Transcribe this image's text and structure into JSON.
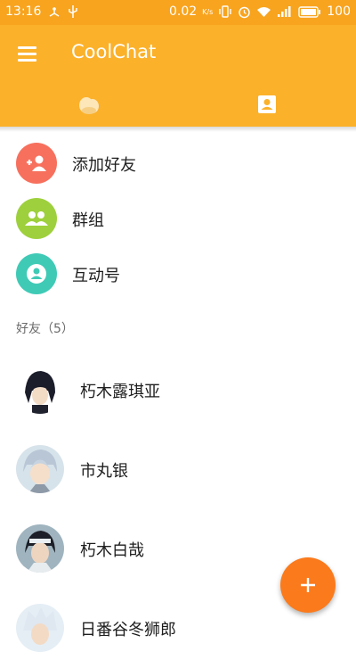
{
  "status_bar": {
    "time": "13:16",
    "net_speed": "0.02",
    "net_unit": "K/s",
    "battery": "100",
    "icons": [
      "usb-share-icon",
      "usb-icon",
      "vibrate-icon",
      "alarm-icon",
      "wifi-icon",
      "signal-icon",
      "battery-icon"
    ]
  },
  "app": {
    "title": "CoolChat",
    "accent": "#fbb12a",
    "status_color": "#f8a41f"
  },
  "tabs": [
    {
      "name": "conversations",
      "icon": "mascot-icon",
      "active": false
    },
    {
      "name": "contacts",
      "icon": "contact-card-icon",
      "active": true
    }
  ],
  "actions": [
    {
      "label": "添加好友",
      "icon": "add-person-icon",
      "color": "#f7705d"
    },
    {
      "label": "群组",
      "icon": "group-icon",
      "color": "#9ed03d"
    },
    {
      "label": "互动号",
      "icon": "account-circle-icon",
      "color": "#3fcab6"
    }
  ],
  "friends_header": "好友（5）",
  "friends": [
    {
      "name": "朽木露琪亚"
    },
    {
      "name": "市丸银"
    },
    {
      "name": "朽木白哉"
    },
    {
      "name": "日番谷冬狮郎"
    }
  ],
  "fab": {
    "icon": "plus-icon",
    "color": "#fb7a1b"
  }
}
